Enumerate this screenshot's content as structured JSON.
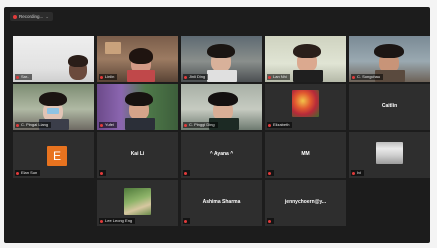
{
  "recording": {
    "label": "Recording..."
  },
  "tiles": [
    {
      "name": "Sar..",
      "type": "video"
    },
    {
      "name": "Linlin",
      "type": "video"
    },
    {
      "name": "Jinli Ding",
      "type": "video"
    },
    {
      "name": "Lan Nhi",
      "type": "video"
    },
    {
      "name": "C. Songchau",
      "type": "video"
    },
    {
      "name": "C. Pingai Liang",
      "type": "video"
    },
    {
      "name": "Yufei",
      "type": "video"
    },
    {
      "name": "C. Pinggi Ding",
      "type": "video"
    },
    {
      "name": "Elizabeth",
      "type": "image"
    },
    {
      "name": "Caitlin",
      "type": "text"
    },
    {
      "name": "Elan Sun",
      "type": "avatar",
      "initial": "E"
    },
    {
      "name": "Kai Li",
      "type": "text"
    },
    {
      "name": "^ Ayana ^",
      "type": "text"
    },
    {
      "name": "MM",
      "type": "text"
    },
    {
      "name": "Ivi",
      "type": "image"
    },
    {
      "name": "Lee Leong Eng",
      "type": "image"
    },
    {
      "name": "Ashima Sharma",
      "type": "text"
    },
    {
      "name": "jennychoern@y...",
      "type": "text"
    }
  ]
}
